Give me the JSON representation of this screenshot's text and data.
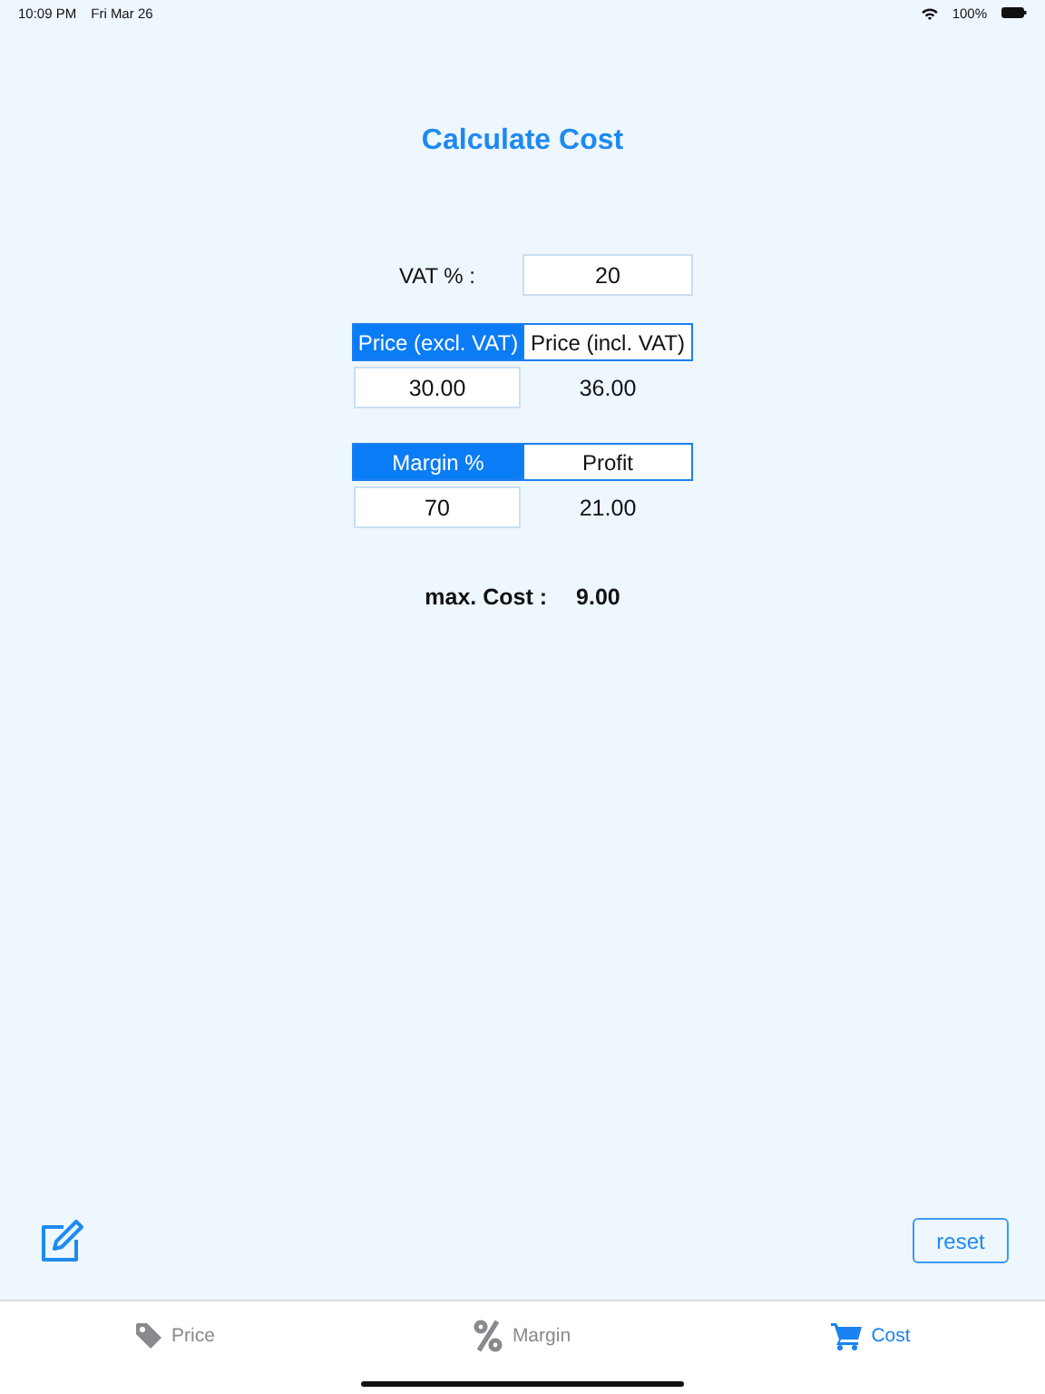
{
  "status_bar": {
    "time": "10:09 PM",
    "date": "Fri Mar 26",
    "battery": "100%"
  },
  "title": "Calculate Cost",
  "vat": {
    "label": "VAT % :",
    "value": "20"
  },
  "price": {
    "segments": [
      {
        "label": "Price (excl. VAT)",
        "selected": true
      },
      {
        "label": "Price (incl. VAT)",
        "selected": false
      }
    ],
    "value": "30.00",
    "result": "36.00"
  },
  "margin": {
    "segments": [
      {
        "label": "Margin %",
        "selected": true
      },
      {
        "label": "Profit",
        "selected": false
      }
    ],
    "value": "70",
    "result": "21.00"
  },
  "result": {
    "label": "max. Cost :",
    "value": "9.00"
  },
  "reset_button": "reset",
  "tabs": [
    {
      "label": "Price",
      "selected": false
    },
    {
      "label": "Margin",
      "selected": false
    },
    {
      "label": "Cost",
      "selected": true
    }
  ]
}
